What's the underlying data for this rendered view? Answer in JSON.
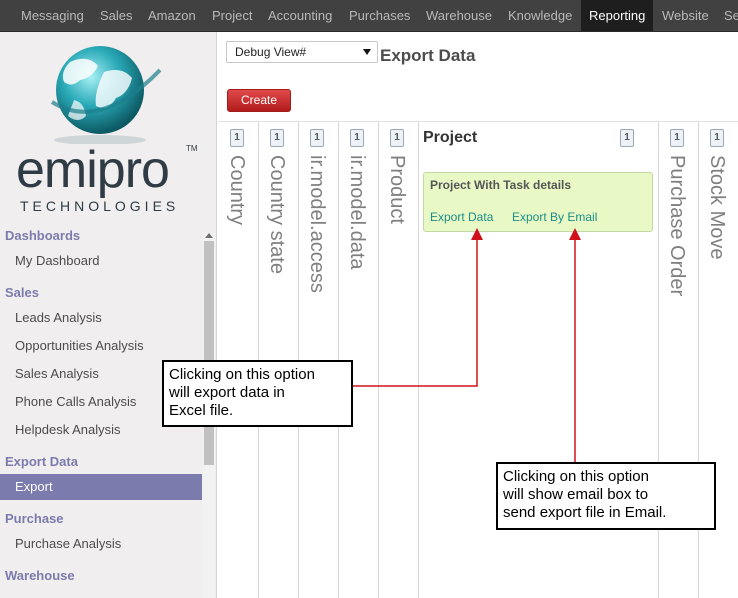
{
  "topnav": {
    "items": [
      "Messaging",
      "Sales",
      "Amazon",
      "Project",
      "Accounting",
      "Purchases",
      "Warehouse",
      "Knowledge",
      "Reporting",
      "Website",
      "Se"
    ],
    "active": "Reporting"
  },
  "logo": {
    "brand": "emipro",
    "trademark": "TM",
    "subtitle": "TECHNOLOGIES"
  },
  "sidebar": {
    "sections": [
      {
        "title": "Dashboards",
        "items": [
          "My Dashboard"
        ]
      },
      {
        "title": "Sales",
        "items": [
          "Leads Analysis",
          "Opportunities Analysis",
          "Sales Analysis",
          "Phone Calls Analysis",
          "Helpdesk Analysis"
        ]
      },
      {
        "title": "Export Data",
        "items": [
          "Export"
        ]
      },
      {
        "title": "Purchase",
        "items": [
          "Purchase Analysis"
        ]
      },
      {
        "title": "Warehouse",
        "items": []
      }
    ],
    "active_item": "Export"
  },
  "main": {
    "view_select": "Debug View#",
    "title": "Export Data",
    "create_label": "Create",
    "columns": [
      {
        "label": "Country",
        "count": "1"
      },
      {
        "label": "Country state",
        "count": "1"
      },
      {
        "label": "ir.model.access",
        "count": "1"
      },
      {
        "label": "ir.model.data",
        "count": "1"
      },
      {
        "label": "Product",
        "count": "1"
      },
      {
        "label": "Project",
        "count": "1"
      },
      {
        "label": "Purchase Order",
        "count": "1"
      },
      {
        "label": "Stock Move",
        "count": "1"
      }
    ],
    "card": {
      "title": "Project With Task details",
      "export_link": "Export Data",
      "email_link": "Export By Email"
    }
  },
  "callouts": {
    "export_data": [
      "Clicking on this option",
      "will export data in",
      "Excel file."
    ],
    "export_email": [
      "Clicking on this option",
      "will show email box to",
      "send export file in Email."
    ]
  },
  "colors": {
    "nav_bg": "#414141",
    "sidebar_accent": "#7c7bad",
    "create_button": "#c62828",
    "card_bg": "#e8f9c6",
    "link": "#1c8f88",
    "annotation_arrow": "#d0111b"
  }
}
